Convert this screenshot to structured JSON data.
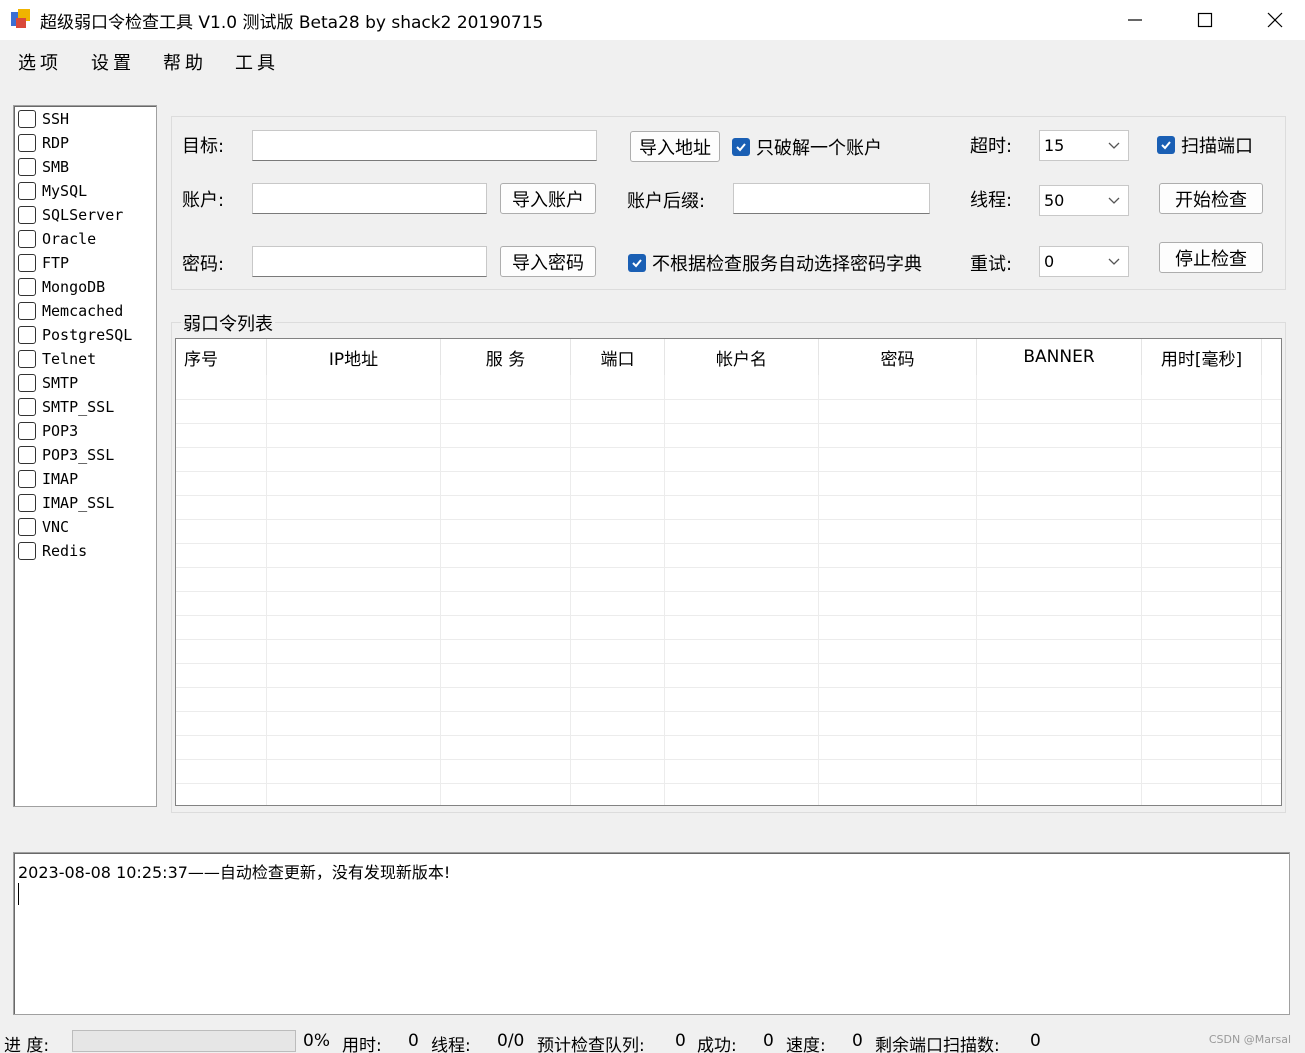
{
  "window": {
    "title": "超级弱口令检查工具 V1.0 测试版 Beta28 by shack2 20190715"
  },
  "menu": [
    "选项",
    "设置",
    "帮助",
    "工具"
  ],
  "protocols": [
    "SSH",
    "RDP",
    "SMB",
    "MySQL",
    "SQLServer",
    "Oracle",
    "FTP",
    "MongoDB",
    "Memcached",
    "PostgreSQL",
    "Telnet",
    "SMTP",
    "SMTP_SSL",
    "POP3",
    "POP3_SSL",
    "IMAP",
    "IMAP_SSL",
    "VNC",
    "Redis"
  ],
  "form": {
    "target_label": "目标:",
    "target_value": "",
    "account_label": "账户:",
    "account_value": "",
    "password_label": "密码:",
    "password_value": "",
    "import_address_btn": "导入地址",
    "import_account_btn": "导入账户",
    "import_password_btn": "导入密码",
    "crack_one_label": "只破解一个账户",
    "crack_one_checked": true,
    "account_suffix_label": "账户后缀:",
    "account_suffix_value": "",
    "no_auto_dict_label": "不根据检查服务自动选择密码字典",
    "no_auto_dict_checked": true,
    "timeout_label": "超时:",
    "timeout_value": "15",
    "threads_label": "线程:",
    "threads_value": "50",
    "retry_label": "重试:",
    "retry_value": "0",
    "scan_port_label": "扫描端口",
    "scan_port_checked": true,
    "start_btn": "开始检查",
    "stop_btn": "停止检查"
  },
  "results": {
    "group_title": "弱口令列表",
    "columns": [
      "序号",
      "IP地址",
      "服 务",
      "端口",
      "帐户名",
      "密码",
      "BANNER",
      "用时[毫秒]"
    ],
    "rows": []
  },
  "log": {
    "lines": [
      "2023-08-08 10:25:37——自动检查更新，没有发现新版本!"
    ]
  },
  "status": {
    "progress_label": "进 度:",
    "progress_percent": "0%",
    "progress_fraction": 0,
    "time_label": "用时:",
    "time_value": "0",
    "threads_label": "线程:",
    "threads_value": "0/0",
    "queue_label": "预计检查队列:",
    "queue_value": "0",
    "success_label": "成功:",
    "success_value": "0",
    "speed_label": "速度:",
    "speed_value": "0",
    "ports_label": "剩余端口扫描数:",
    "ports_value": "0",
    "watermark": "CSDN @Marsal"
  },
  "colors": {
    "checkbox_checked": "#1a5fb4",
    "window_bg": "#f0f0f0"
  }
}
